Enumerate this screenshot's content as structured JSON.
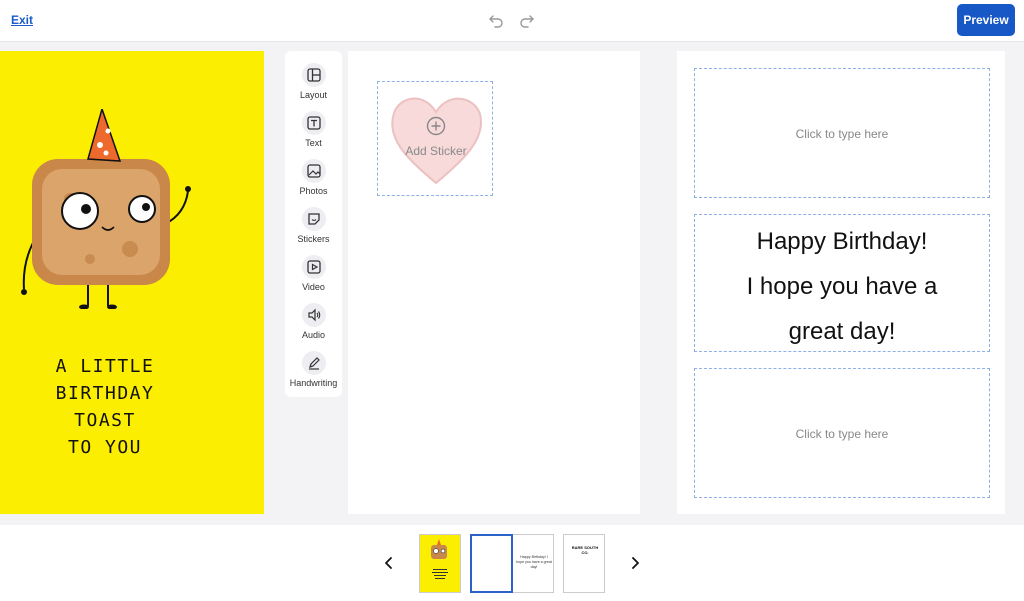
{
  "topbar": {
    "exit_label": "Exit",
    "undo_icon": "undo-icon",
    "redo_icon": "redo-icon",
    "preview_label": "Preview"
  },
  "card_front": {
    "lines": [
      "A LITTLE",
      "BIRTHDAY",
      "TOAST",
      "TO YOU"
    ],
    "background": "#fcee00"
  },
  "tools": [
    {
      "label": "Layout",
      "icon": "layout-icon"
    },
    {
      "label": "Text",
      "icon": "text-icon"
    },
    {
      "label": "Photos",
      "icon": "photo-icon"
    },
    {
      "label": "Stickers",
      "icon": "sticker-icon"
    },
    {
      "label": "Video",
      "icon": "video-icon"
    },
    {
      "label": "Audio",
      "icon": "audio-icon"
    },
    {
      "label": "Handwriting",
      "icon": "pen-icon"
    }
  ],
  "sticker": {
    "label": "Add Sticker"
  },
  "text_boxes": {
    "top_placeholder": "Click to type here",
    "message_lines": [
      "Happy Birthday!",
      "I hope you have a",
      "great day!"
    ],
    "bottom_placeholder": "Click to type here"
  },
  "thumbnails": {
    "inside_text": "Happy Birthday! I hope you have a great day!",
    "back_text": "RARE SOUTH CO."
  },
  "colors": {
    "accent": "#1858c6",
    "dashed": "#8fb0e6",
    "card_yellow": "#fcee00"
  }
}
